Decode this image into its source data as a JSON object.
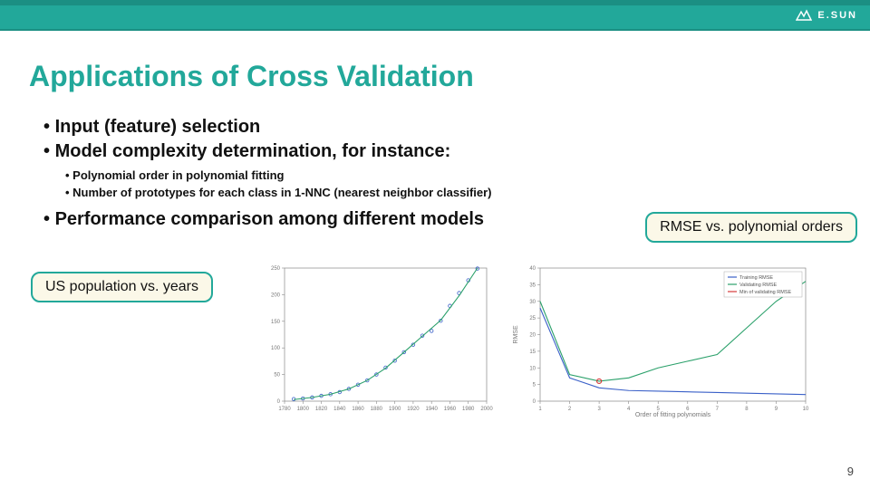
{
  "brand": "E.SUN",
  "title": "Applications of Cross Validation",
  "bullets_l1": [
    "Input (feature) selection",
    "Model complexity determination, for instance:"
  ],
  "bullets_l2": [
    "Polynomial order in polynomial fitting",
    "Number of prototypes for each class in 1-NNC (nearest neighbor classifier)"
  ],
  "bullets_l1b": [
    "Performance comparison among different models"
  ],
  "callout_left": "US population vs. years",
  "callout_right": "RMSE vs. polynomial orders",
  "page_number": "9",
  "chart_data": [
    {
      "type": "scatter",
      "title": "",
      "xlabel": "",
      "ylabel": "",
      "xlim": [
        1780,
        2000
      ],
      "ylim": [
        0,
        250
      ],
      "xticks": [
        1780,
        1800,
        1820,
        1840,
        1860,
        1880,
        1900,
        1920,
        1940,
        1960,
        1980,
        2000
      ],
      "yticks": [
        0,
        50,
        100,
        150,
        200,
        250
      ],
      "series": [
        {
          "name": "data",
          "style": "circles",
          "color": "#3a60c8",
          "x": [
            1790,
            1800,
            1810,
            1820,
            1830,
            1840,
            1850,
            1860,
            1870,
            1880,
            1890,
            1900,
            1910,
            1920,
            1930,
            1940,
            1950,
            1960,
            1970,
            1980,
            1990
          ],
          "y": [
            4,
            5,
            7,
            10,
            13,
            17,
            23,
            31,
            39,
            50,
            63,
            76,
            92,
            106,
            123,
            132,
            151,
            179,
            203,
            227,
            249
          ]
        },
        {
          "name": "fit",
          "style": "line",
          "color": "#2aa06a",
          "x": [
            1790,
            1810,
            1830,
            1850,
            1870,
            1890,
            1910,
            1930,
            1950,
            1970,
            1990
          ],
          "y": [
            3,
            7,
            13,
            23,
            39,
            62,
            92,
            122,
            152,
            198,
            250
          ]
        }
      ]
    },
    {
      "type": "line",
      "title": "",
      "xlabel": "Order of fitting polynomials",
      "ylabel": "RMSE",
      "xlim": [
        1,
        10
      ],
      "ylim": [
        0,
        40
      ],
      "xticks": [
        1,
        2,
        3,
        4,
        5,
        6,
        7,
        8,
        9,
        10
      ],
      "yticks": [
        0,
        5,
        10,
        15,
        20,
        25,
        30,
        35,
        40
      ],
      "legend": [
        "Training RMSE",
        "Validating RMSE",
        "Min of validating RMSE"
      ],
      "series": [
        {
          "name": "Training RMSE",
          "color": "#3a60c8",
          "x": [
            1,
            2,
            3,
            4,
            5,
            6,
            7,
            8,
            9,
            10
          ],
          "y": [
            28,
            7,
            4,
            3.2,
            3,
            2.8,
            2.6,
            2.4,
            2.2,
            2
          ]
        },
        {
          "name": "Validating RMSE",
          "color": "#2aa06a",
          "x": [
            1,
            2,
            3,
            4,
            5,
            6,
            7,
            8,
            9,
            10
          ],
          "y": [
            30,
            8,
            6,
            7,
            10,
            12,
            14,
            22,
            30,
            36
          ]
        },
        {
          "name": "Min of validating RMSE",
          "color": "#d43a3a",
          "style": "point",
          "x": [
            3
          ],
          "y": [
            6
          ]
        }
      ]
    }
  ]
}
